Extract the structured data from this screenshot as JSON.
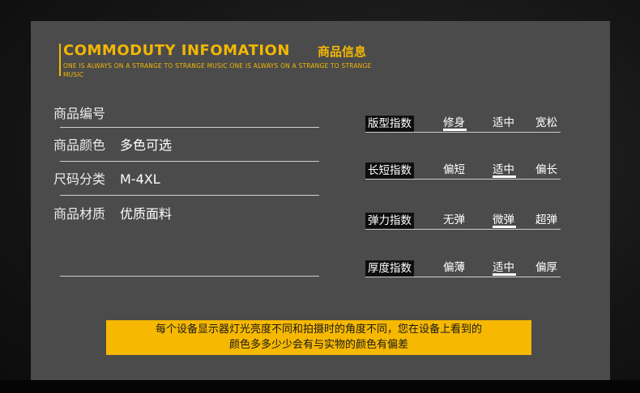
{
  "header": {
    "title_en": "COMMODUTY INFOMATION",
    "title_cn": "商品信息",
    "subtitle": "ONE IS ALWAYS ON A STRANGE TO STRANGE MUSIC ONE IS ALWAYS ON A STRANGE TO STRANGE MUSIC"
  },
  "specs": [
    {
      "label": "商品编号",
      "value": ""
    },
    {
      "label": "商品颜色",
      "value": "多色可选"
    },
    {
      "label": "尺码分类",
      "value": "M-4XL"
    },
    {
      "label": "商品材质",
      "value": "优质面料"
    }
  ],
  "indices": [
    {
      "label": "版型指数",
      "options": [
        "修身",
        "适中",
        "宽松"
      ],
      "selected": 0
    },
    {
      "label": "长短指数",
      "options": [
        "偏短",
        "适中",
        "偏长"
      ],
      "selected": 1
    },
    {
      "label": "弹力指数",
      "options": [
        "无弹",
        "微弹",
        "超弹"
      ],
      "selected": 1
    },
    {
      "label": "厚度指数",
      "options": [
        "偏薄",
        "适中",
        "偏厚"
      ],
      "selected": 1
    }
  ],
  "notice": {
    "line1": "每个设备显示器灯光亮度不同和拍摄时的角度不同，您在设备上看到的",
    "line2": "颜色多多少少会有与实物的颜色有偏差"
  },
  "colors": {
    "accent": "#f2b705",
    "panel": "#4b4b4b",
    "notice_bg": "#f6b800"
  }
}
